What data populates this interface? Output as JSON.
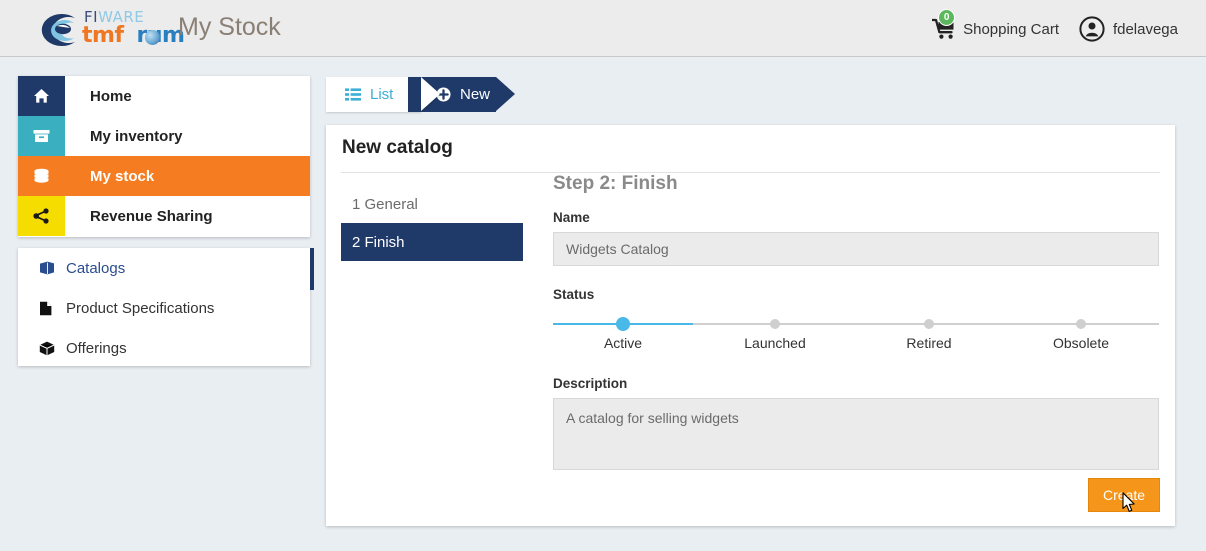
{
  "header": {
    "logo": {
      "fi": "FI",
      "ware": "WARE",
      "tm": "tm",
      "forum_o": "f",
      "forum_rest": "rum",
      "icon": "fiware-tmforum-logo"
    },
    "app_title": "My Stock",
    "cart": {
      "label": "Shopping Cart",
      "badge_count": "0",
      "icon": "shopping-cart-icon",
      "badge_color": "#5cb85c"
    },
    "user": {
      "name": "fdelavega",
      "icon": "user-avatar-icon"
    }
  },
  "sidebar": {
    "main_items": [
      {
        "label": "Home",
        "icon": "home-icon",
        "color": "#1f3a68",
        "active": false
      },
      {
        "label": "My inventory",
        "icon": "box-icon",
        "color": "#3aafc0",
        "active": false
      },
      {
        "label": "My stock",
        "icon": "database-icon",
        "color": "#f57c20",
        "active": true
      },
      {
        "label": "Revenue Sharing",
        "icon": "share-icon",
        "color": "#f5dd00",
        "active": false
      }
    ],
    "sub_items": [
      {
        "label": "Catalogs",
        "icon": "book-icon",
        "selected": true
      },
      {
        "label": "Product Specifications",
        "icon": "file-icon",
        "selected": false
      },
      {
        "label": "Offerings",
        "icon": "package-icon",
        "selected": false
      }
    ],
    "accent_color": "#1f3a68"
  },
  "tabs": [
    {
      "label": "List",
      "icon": "list-icon",
      "active": false
    },
    {
      "label": "New",
      "icon": "plus-circle-icon",
      "active": true
    }
  ],
  "panel": {
    "title": "New catalog",
    "steps": [
      {
        "label": "1 General",
        "current": false
      },
      {
        "label": "2 Finish",
        "current": true
      }
    ],
    "step_heading": "Step 2: Finish",
    "fields": {
      "name_label": "Name",
      "name_value": "Widgets Catalog",
      "status_label": "Status",
      "description_label": "Description",
      "description_value": "A catalog for selling widgets"
    },
    "status_slider": {
      "options": [
        "Active",
        "Launched",
        "Retired",
        "Obsolete"
      ],
      "selected": "Active",
      "selected_index": 0,
      "fill_color": "#49bae8",
      "track_color": "#cfcfcf"
    },
    "create_label": "Create",
    "create_color": "#f59519"
  }
}
